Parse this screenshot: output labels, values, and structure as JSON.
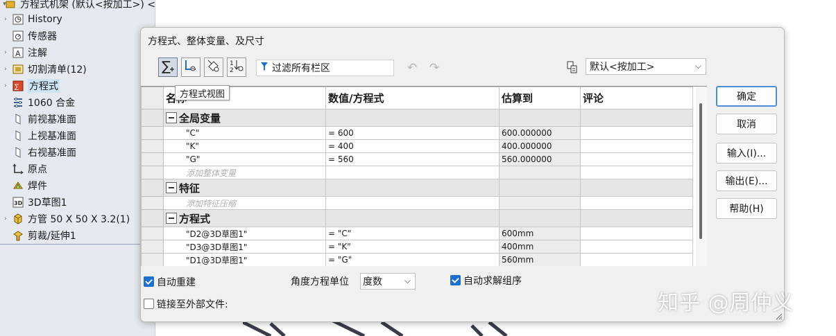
{
  "feature_tree": {
    "root_label": "方程式机架 (默认<按加工>) <",
    "items": [
      {
        "label": "History",
        "icon": "history-icon",
        "expandable": true
      },
      {
        "label": "传感器",
        "icon": "sensor-icon",
        "expandable": false
      },
      {
        "label": "注解",
        "icon": "annotation-icon",
        "expandable": true
      },
      {
        "label": "切割清单(12)",
        "icon": "cut-list-icon",
        "expandable": true
      },
      {
        "label": "方程式",
        "icon": "equations-icon",
        "expandable": true,
        "selected": true
      },
      {
        "label": "1060 合金",
        "icon": "material-icon",
        "expandable": false
      },
      {
        "label": "前视基准面",
        "icon": "plane-icon",
        "expandable": false
      },
      {
        "label": "上视基准面",
        "icon": "plane-icon",
        "expandable": false
      },
      {
        "label": "右视基准面",
        "icon": "plane-icon",
        "expandable": false
      },
      {
        "label": "原点",
        "icon": "origin-icon",
        "expandable": false
      },
      {
        "label": "焊件",
        "icon": "weldment-icon",
        "expandable": false
      },
      {
        "label": "3D草图1",
        "icon": "sketch3d-icon",
        "expandable": false
      },
      {
        "label": "方管 50 X 50 X 3.2(1)",
        "icon": "structural-member-icon",
        "expandable": true
      },
      {
        "label": "剪裁/延伸1",
        "icon": "trim-extend-icon",
        "expandable": false
      }
    ]
  },
  "dialog": {
    "title": "方程式、整体变量、及尺寸",
    "toolbar": {
      "buttons": [
        "equation-view-icon",
        "sketch-equation-view-icon",
        "dimension-view-icon",
        "ordered-view-icon"
      ],
      "filter_placeholder": "过滤所有栏区",
      "tooltip": "方程式视图",
      "configuration": "默认<按加工>"
    },
    "table": {
      "headers": [
        "名称",
        "数值/方程式",
        "估算到",
        "评论"
      ],
      "sections": [
        {
          "title": "全局变量",
          "rows": [
            {
              "name": "\"C\"",
              "value": "= 600",
              "evaluates": "600.000000",
              "comment": ""
            },
            {
              "name": "\"K\"",
              "value": "= 400",
              "evaluates": "400.000000",
              "comment": ""
            },
            {
              "name": "\"G\"",
              "value": "= 560",
              "evaluates": "560.000000",
              "comment": ""
            }
          ],
          "add_text": "添加整体变量"
        },
        {
          "title": "特征",
          "rows": [],
          "add_text": "添加特征压缩"
        },
        {
          "title": "方程式",
          "rows": [
            {
              "name": "\"D2@3D草图1\"",
              "value": "= \"C\"",
              "evaluates": "600mm",
              "comment": ""
            },
            {
              "name": "\"D3@3D草图1\"",
              "value": "= \"K\"",
              "evaluates": "400mm",
              "comment": ""
            },
            {
              "name": "\"D1@3D草图1\"",
              "value": "= \"G\"",
              "evaluates": "560mm",
              "comment": ""
            }
          ]
        }
      ]
    },
    "buttons": {
      "ok": "确定",
      "cancel": "取消",
      "import": "输入(I)...",
      "export": "输出(E)...",
      "help": "帮助(H)"
    },
    "options": {
      "auto_rebuild": {
        "label": "自动重建",
        "checked": true
      },
      "angle_unit_label": "角度方程单位",
      "angle_unit_value": "度数",
      "auto_solve": {
        "label": "自动求解组序",
        "checked": true
      },
      "link_external": {
        "label": "链接至外部文件:",
        "checked": false
      }
    }
  },
  "watermark": "知乎 @周仲义",
  "colors": {
    "accent": "#1a6fd1",
    "tree_bg": "#e6e9ef",
    "dialog_bg": "#f0f0f0",
    "section_bg": "#e6e6e6"
  }
}
